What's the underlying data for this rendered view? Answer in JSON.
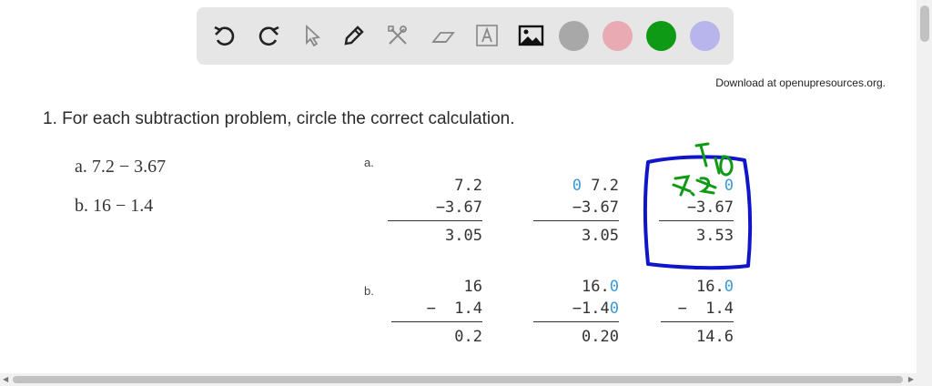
{
  "toolbar": {
    "tools": [
      {
        "name": "undo-icon"
      },
      {
        "name": "redo-icon"
      },
      {
        "name": "pointer-icon"
      },
      {
        "name": "pen-icon"
      },
      {
        "name": "tools-icon"
      },
      {
        "name": "eraser-icon"
      },
      {
        "name": "text-icon"
      },
      {
        "name": "image-icon"
      }
    ],
    "colors": [
      "#a8a8a8",
      "#e9aab4",
      "#0f9a16",
      "#b7b5ec"
    ],
    "selected_color": "#0f9a16"
  },
  "header": {
    "download_text": "Download at openupresources.org."
  },
  "question": {
    "text": "1. For each subtraction problem, circle the correct calculation.",
    "part_a": "a. 7.2 − 3.67",
    "part_b": "b. 16 − 1.4"
  },
  "work": {
    "label_a": "a.",
    "label_b": "b.",
    "a1": {
      "top": "7.2",
      "bottom": "−3.67",
      "result": "3.05"
    },
    "a2": {
      "top_pad": "0",
      "top": "7.2",
      "bottom": "−3.67",
      "result": "3.05"
    },
    "a3": {
      "top_pad": "0",
      "bottom": "−3.67",
      "result": "3.53"
    },
    "b1": {
      "top": "16",
      "bottom": "−  1.4",
      "result": "0.2"
    },
    "b2": {
      "top": "16.",
      "top_pad": "0",
      "bottom": "−1.4",
      "bottom_pad": "0",
      "result": "0.20"
    },
    "b3": {
      "top": "16.",
      "top_pad": "0",
      "bottom": "−  1.4",
      "result": "14.6"
    }
  },
  "annotations": {
    "ink_color": "#0f9a16",
    "circle_color": "#1015c9"
  }
}
